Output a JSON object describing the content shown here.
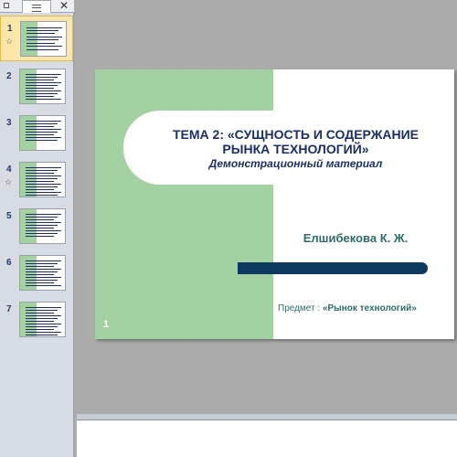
{
  "pane": {
    "tabs": {
      "close_glyph": "✕"
    },
    "thumbnails": [
      {
        "number": "1",
        "has_animation": true,
        "active": true
      },
      {
        "number": "2",
        "has_animation": false,
        "active": false
      },
      {
        "number": "3",
        "has_animation": false,
        "active": false
      },
      {
        "number": "4",
        "has_animation": true,
        "active": false
      },
      {
        "number": "5",
        "has_animation": false,
        "active": false
      },
      {
        "number": "6",
        "has_animation": false,
        "active": false
      },
      {
        "number": "7",
        "has_animation": false,
        "active": false
      }
    ]
  },
  "slide": {
    "title_line1": "ТЕМА 2: «СУЩНОСТЬ И СОДЕРЖАНИЕ",
    "title_line2": "РЫНКА  ТЕХНОЛОГИЙ»",
    "subtitle": "Демонстрационный материал",
    "author": "Елшибекова К. Ж.",
    "subject_label": "Предмет : ",
    "subject_value": "«Рынок технологий»",
    "slide_number": "1"
  },
  "colors": {
    "green_panel": "#a3d1a1",
    "title_text": "#1b2f63",
    "teal_text": "#2e6b68",
    "accent_bar": "#0f3a60",
    "active_thumb": "#fde7a8"
  }
}
